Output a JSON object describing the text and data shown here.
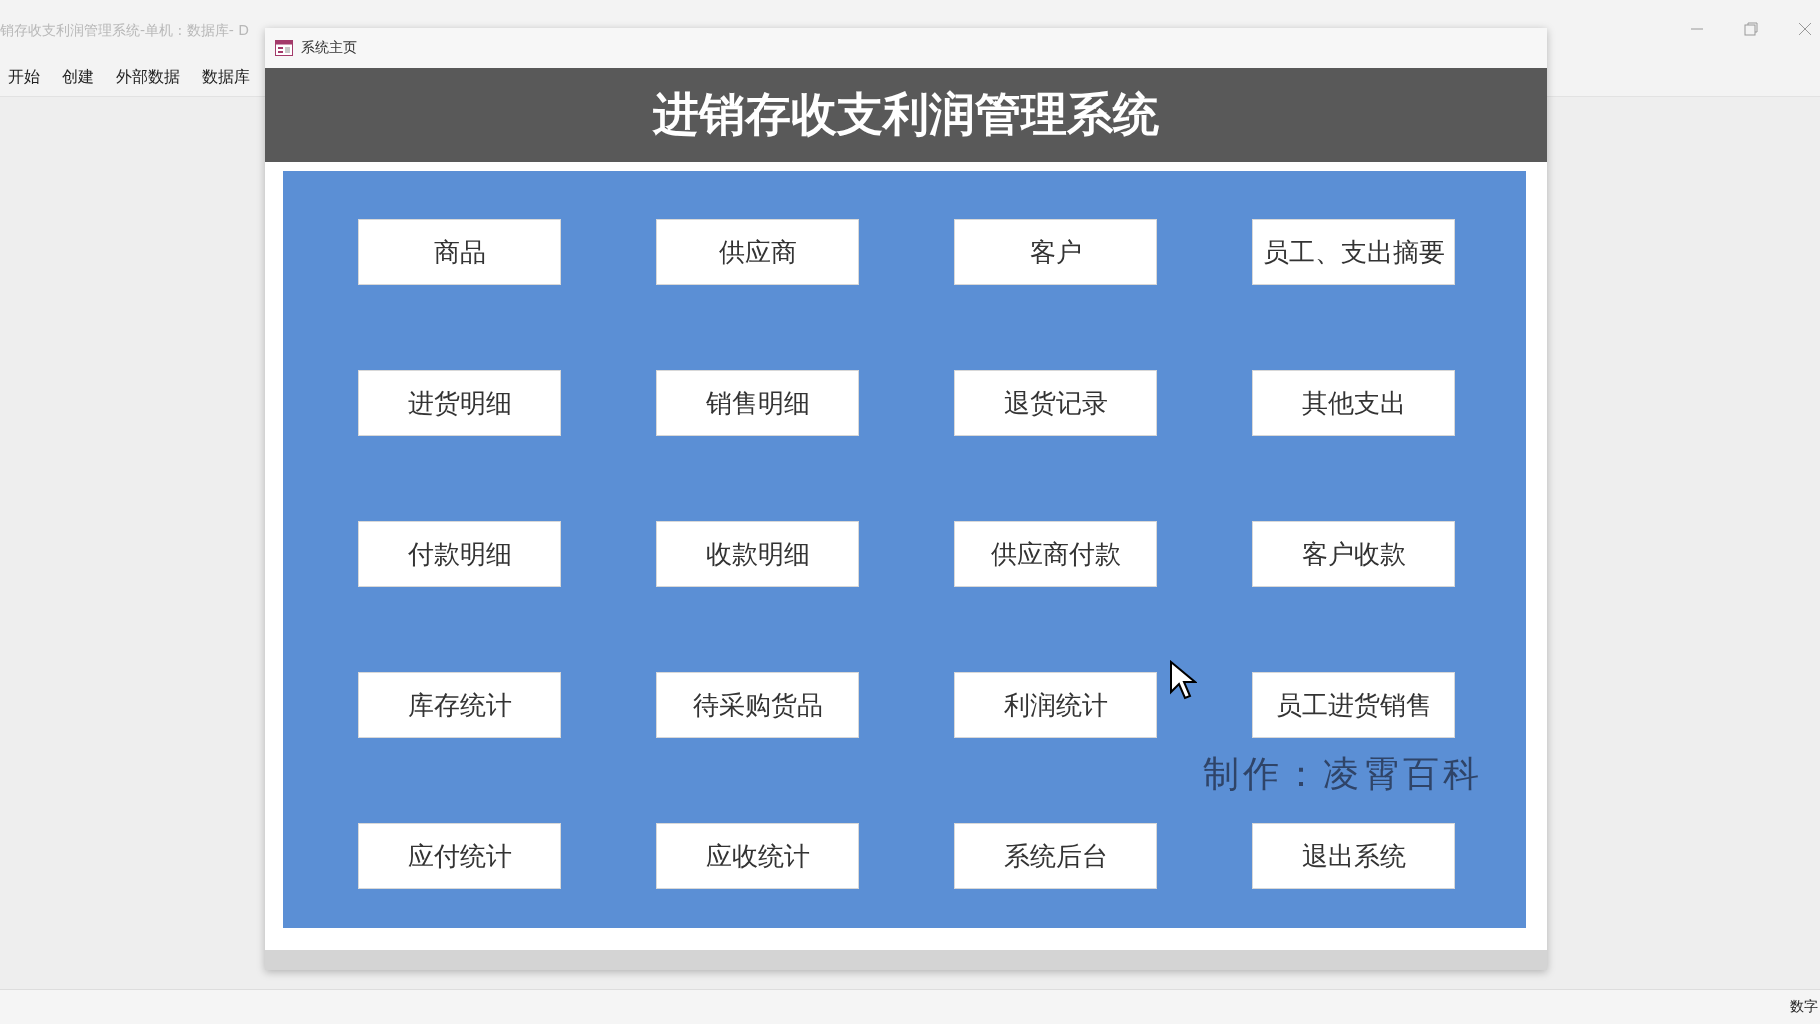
{
  "app_window": {
    "title": "销存收支利润管理系统-单机 : 数据库- D"
  },
  "ribbon_tabs": [
    {
      "label": "开始"
    },
    {
      "label": "创建"
    },
    {
      "label": "外部数据"
    },
    {
      "label": "数据库"
    }
  ],
  "form": {
    "title": "系统主页",
    "heading": "进销存收支利润管理系统",
    "buttons": [
      {
        "label": "商品"
      },
      {
        "label": "供应商"
      },
      {
        "label": "客户"
      },
      {
        "label": "员工、支出摘要"
      },
      {
        "label": "进货明细"
      },
      {
        "label": "销售明细"
      },
      {
        "label": "退货记录"
      },
      {
        "label": "其他支出"
      },
      {
        "label": "付款明细"
      },
      {
        "label": "收款明细"
      },
      {
        "label": "供应商付款"
      },
      {
        "label": "客户收款"
      },
      {
        "label": "库存统计"
      },
      {
        "label": "待采购货品"
      },
      {
        "label": "利润统计"
      },
      {
        "label": "员工进货销售"
      },
      {
        "label": "应付统计"
      },
      {
        "label": "应收统计"
      },
      {
        "label": "系统后台"
      },
      {
        "label": "退出系统"
      }
    ],
    "credit": "制作：凌霄百科"
  },
  "status_bar": {
    "mode": "数字"
  }
}
